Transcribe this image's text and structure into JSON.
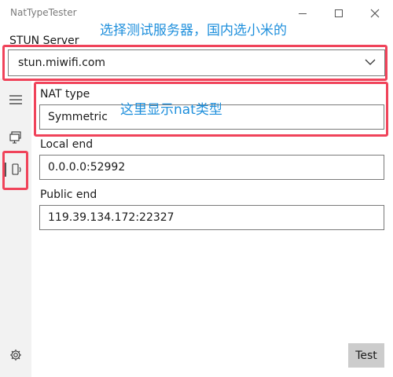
{
  "window": {
    "title": "NatTypeTester"
  },
  "annotations": {
    "server_hint": "选择测试服务器，国内选小米的",
    "nat_hint": "这里显示nat类型"
  },
  "stun": {
    "label": "STUN Server",
    "selected": "stun.miwifi.com"
  },
  "nat": {
    "label": "NAT type",
    "value": "Symmetric"
  },
  "local": {
    "label": "Local end",
    "value": "0.0.0.0:52992"
  },
  "public": {
    "label": "Public end",
    "value": "119.39.134.172:22327"
  },
  "actions": {
    "test_label": "Test"
  },
  "icons": {
    "menu": "hamburger-icon",
    "monitor": "monitor-icon",
    "phone": "phone-icon",
    "settings": "gear-icon"
  },
  "colors": {
    "annotation_box": "#f0435a",
    "annotation_text": "#1e8fdc"
  }
}
